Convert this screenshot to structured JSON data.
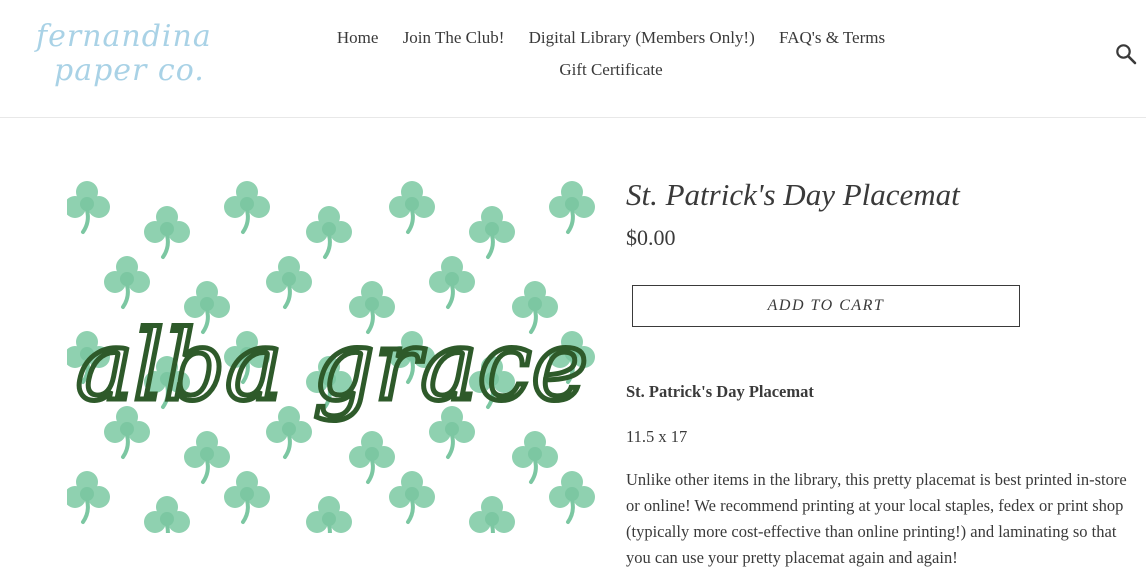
{
  "brand": {
    "logo_line1": "fernandina",
    "logo_line2": "paper co."
  },
  "nav": {
    "items": [
      {
        "label": "Home"
      },
      {
        "label": "Join The Club!"
      },
      {
        "label": "Digital Library (Members Only!)"
      },
      {
        "label": "FAQ's & Terms"
      },
      {
        "label": "Gift Certificate"
      }
    ],
    "search_icon": "search-icon"
  },
  "product": {
    "image_text": "alba grace",
    "title": "St. Patrick's Day Placemat",
    "price": "$0.00",
    "add_to_cart_label": "ADD TO CART",
    "description": {
      "heading": "St. Patrick's Day  Placemat",
      "size": "11.5 x 17",
      "body_lines": [
        "Unlike other items in the library, this pretty placemat is best printed in-store",
        "or online!  We recommend printing at your local staples, fedex or print shop",
        "(typically more cost-effective than online printing!) and laminating so that",
        "you can use your pretty placemat again and again!"
      ]
    }
  },
  "colors": {
    "logo": "#a9d2e6",
    "shamrock": "#8fd1b0",
    "script": "#2e5a2a",
    "text": "#3a3a3a"
  }
}
